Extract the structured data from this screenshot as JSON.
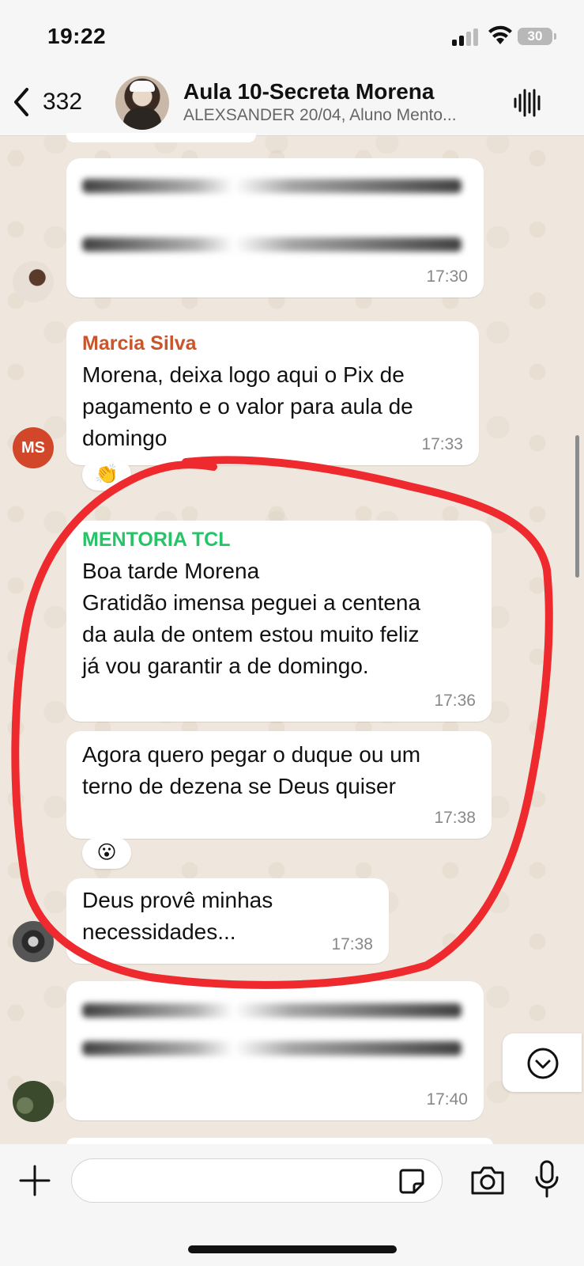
{
  "status_bar": {
    "time": "19:22",
    "battery": "30"
  },
  "header": {
    "unread_count": "332",
    "title": "Aula 10-Secreta Morena",
    "subtitle": "ALEXSANDER 20/04, Aluno Mento..."
  },
  "messages": [
    {
      "id": "m1",
      "sender": "",
      "text": "",
      "time": "17:30",
      "redacted": true
    },
    {
      "id": "m2",
      "sender": "Marcia Silva",
      "sender_color": "#c9552a",
      "text": "Morena, deixa logo aqui o Pix de\npagamento e o valor para aula de\ndomingo",
      "time": "17:33",
      "avatar_initials": "MS"
    },
    {
      "id": "m3",
      "sender": "MENTORIA TCL",
      "sender_color": "#25c467",
      "text": "Boa tarde Morena\nGratidão imensa peguei a centena\nda aula de ontem estou muito feliz\njá vou garantir a de domingo.",
      "time": "17:36"
    },
    {
      "id": "m4",
      "sender": "",
      "text": "Agora quero pegar o duque ou um\nterno de dezena se Deus quiser",
      "time": "17:38",
      "reaction": "😮"
    },
    {
      "id": "m5",
      "sender": "",
      "text": "Deus provê minhas\nnecessidades...",
      "time": "17:38"
    },
    {
      "id": "m6",
      "sender": "",
      "text": "",
      "time": "17:40",
      "redacted": true
    }
  ],
  "reactions": {
    "m2_reaction": "👏",
    "m4_reaction": "😮"
  },
  "composer": {
    "placeholder": ""
  },
  "colors": {
    "annotation_circle": "#ee2a2f",
    "chat_background": "#efe7dd",
    "bubble": "#ffffff"
  }
}
